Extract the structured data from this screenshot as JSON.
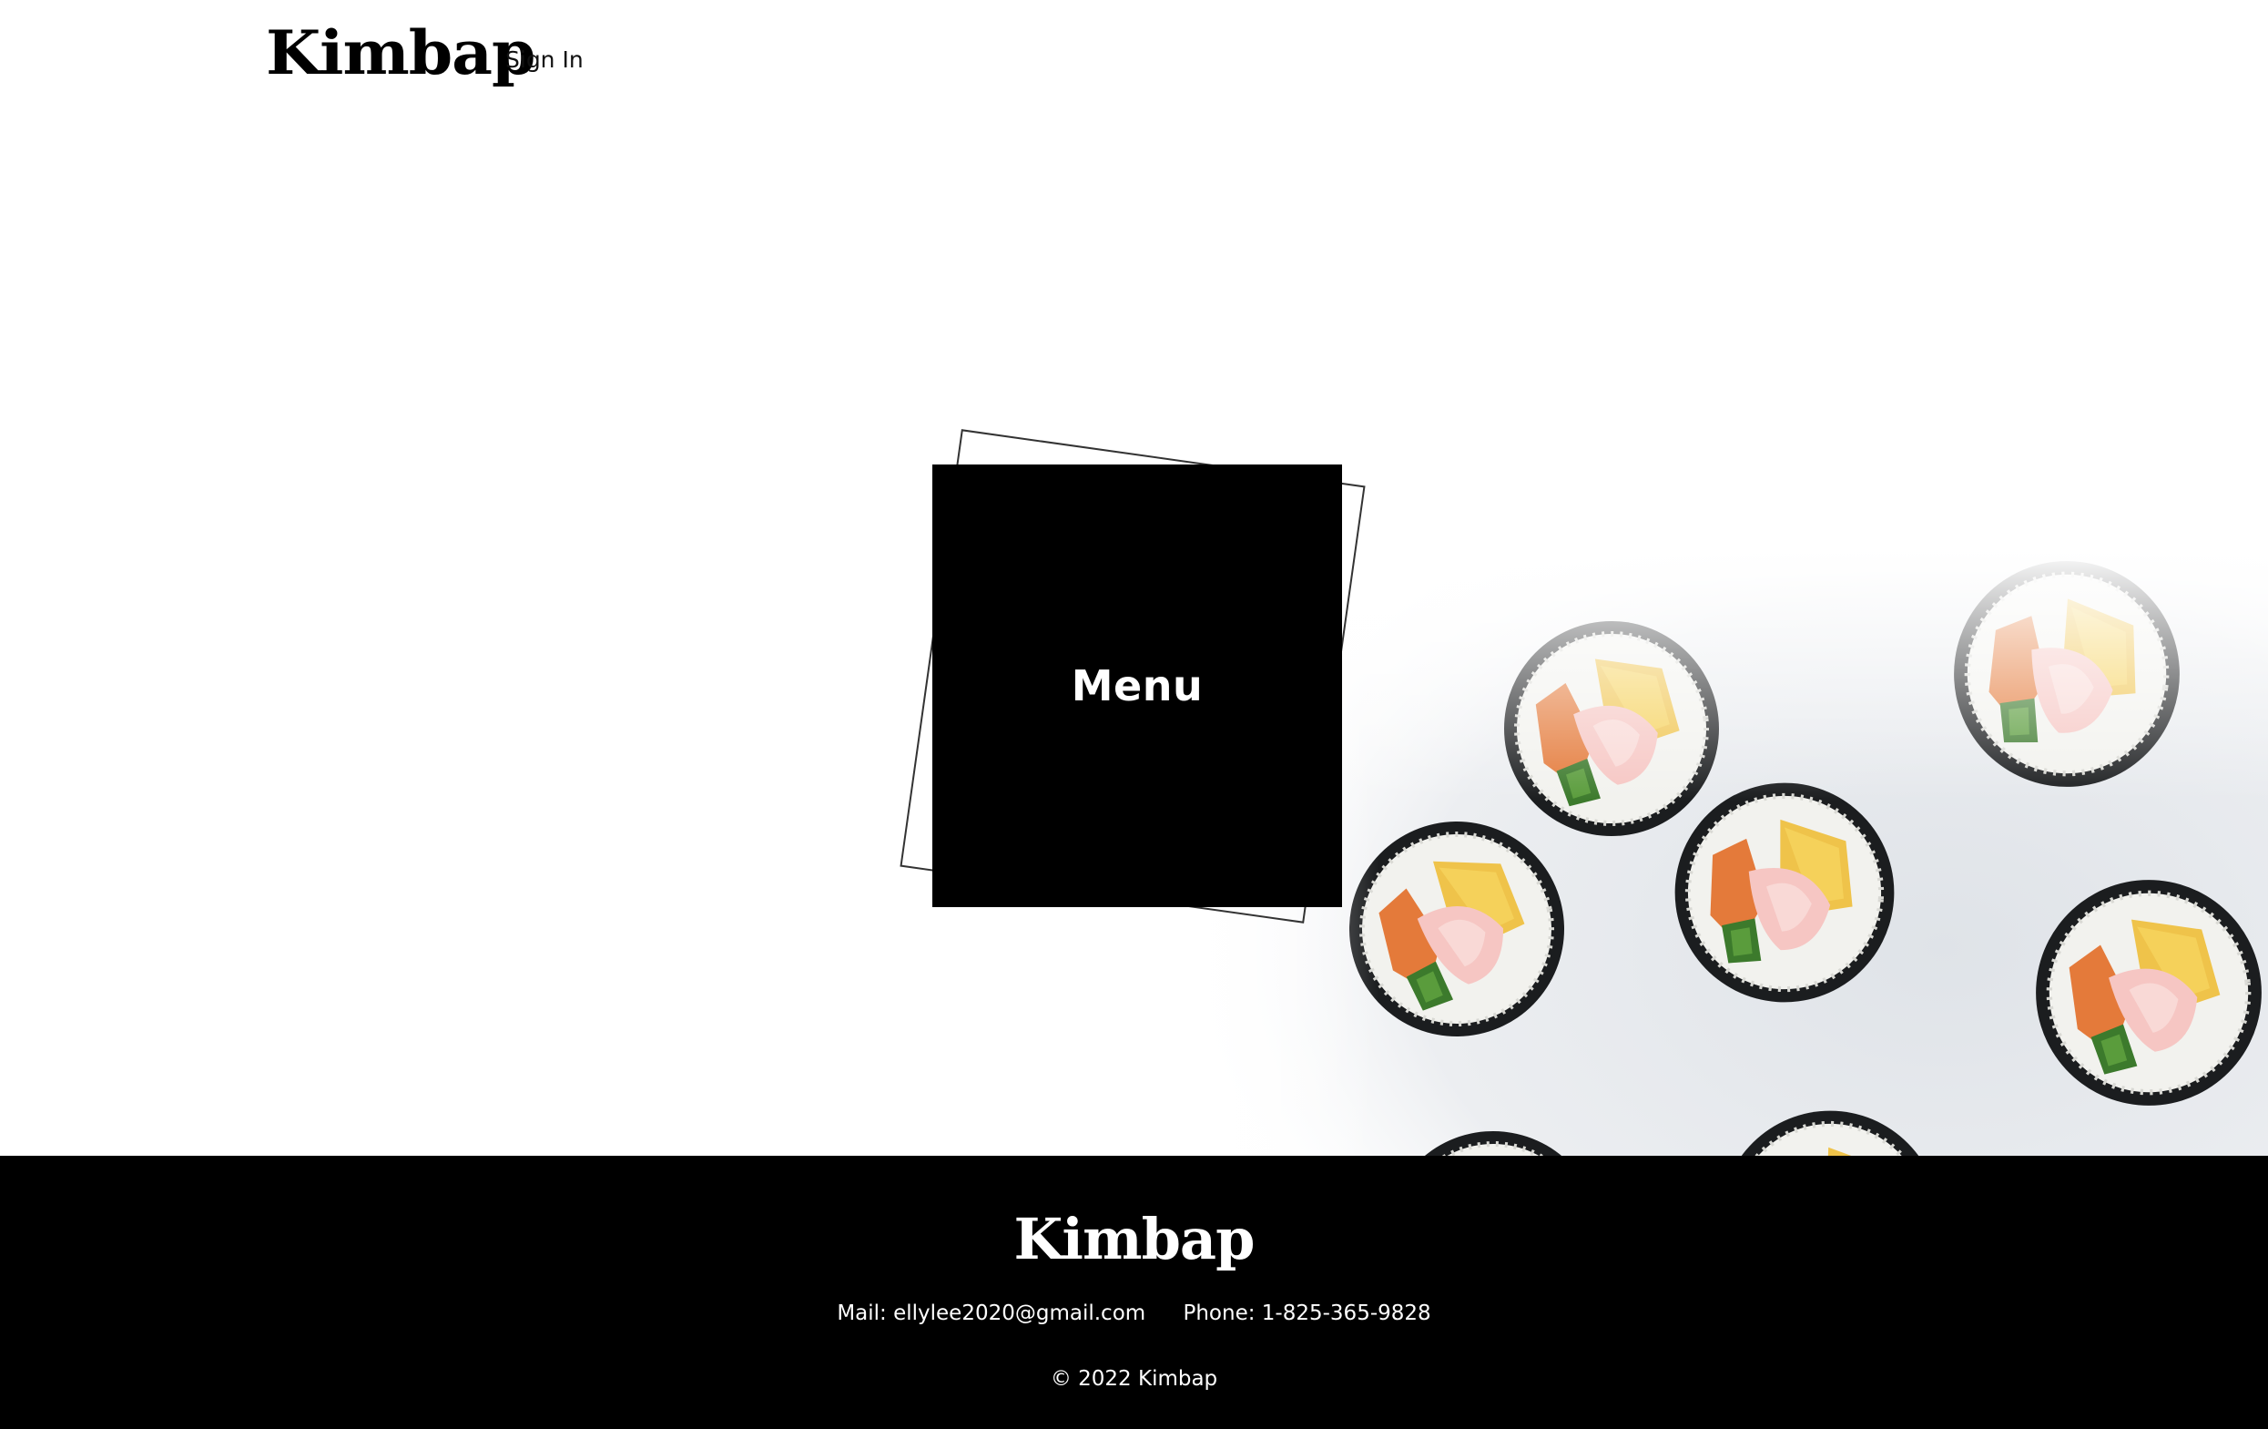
{
  "header": {
    "logo": "Kimbap",
    "signin_label": "Sign In"
  },
  "hero": {
    "menu_label": "Menu",
    "image_icon": "kimbap-photo"
  },
  "footer": {
    "logo": "Kimbap",
    "mail_label": "Mail:",
    "mail_value": "ellylee2020@gmail.com",
    "phone_label": "Phone:",
    "phone_value": "1-825-365-9828",
    "copyright": "© 2022 Kimbap"
  },
  "colors": {
    "background": "#ffffff",
    "footer_bg": "#000000",
    "card_bg": "#000000",
    "text_light": "#ffffff"
  }
}
